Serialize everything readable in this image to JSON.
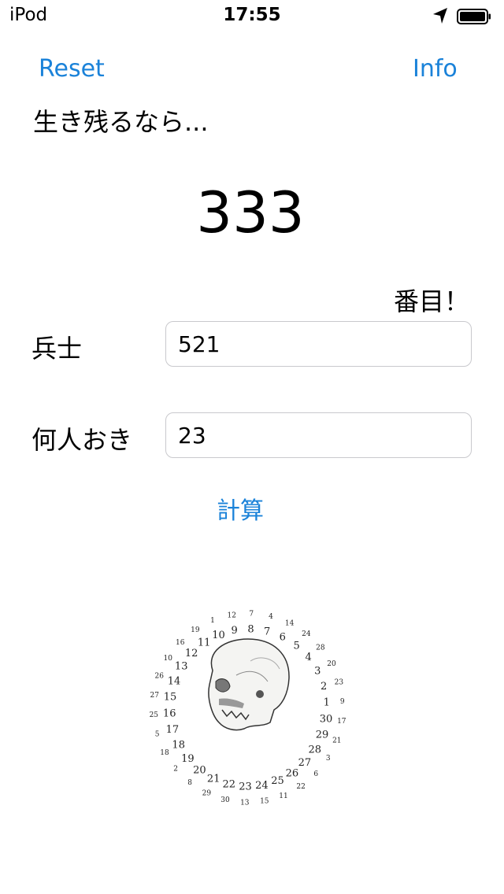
{
  "status_bar": {
    "carrier": "iPod",
    "time": "17:55",
    "location_icon": "location-arrow-icon",
    "battery_icon": "battery-icon"
  },
  "nav": {
    "reset_label": "Reset",
    "info_label": "Info"
  },
  "main": {
    "intro": "生き残るなら...",
    "result": "333",
    "suffix": "番目！",
    "soldiers_label": "兵士",
    "soldiers_value": "521",
    "step_label": "何人おき",
    "step_value": "23",
    "calculate_label": "計算"
  },
  "illustration": {
    "icon": "skull-icon",
    "inner_ring": [
      "9",
      "8",
      "7",
      "6",
      "5",
      "4",
      "3",
      "2",
      "1",
      "30",
      "29",
      "28",
      "27",
      "26",
      "25",
      "24",
      "23",
      "22",
      "21",
      "20",
      "19",
      "18",
      "17",
      "16",
      "15",
      "14",
      "13",
      "12",
      "11",
      "10"
    ],
    "outer_ring": [
      "12",
      "7",
      "4",
      "14",
      "24",
      "28",
      "20",
      "23",
      "9",
      "17",
      "21",
      "3",
      "6",
      "22",
      "11",
      "15",
      "13",
      "30",
      "29",
      "8",
      "2",
      "18",
      "5",
      "25",
      "27",
      "26",
      "10",
      "16",
      "19",
      "1"
    ]
  }
}
